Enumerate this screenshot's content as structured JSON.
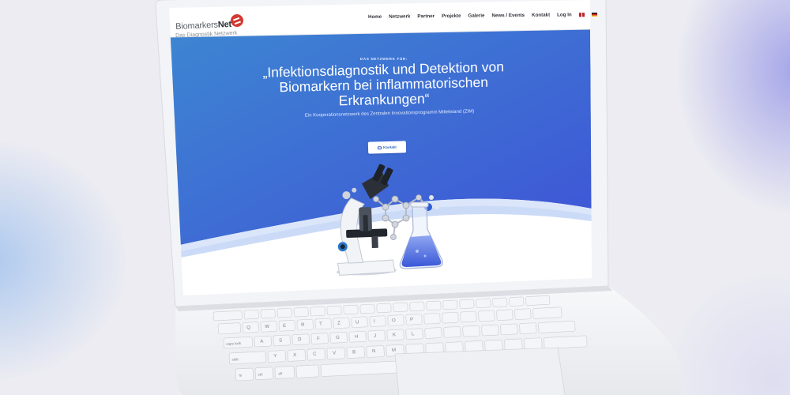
{
  "logo": {
    "name_part1": "Biomarkers",
    "name_part2": "Net",
    "tagline": "Das Diagnostik Netzwerk"
  },
  "nav": {
    "items": [
      "Home",
      "Netzwerk",
      "Partner",
      "Projekte",
      "Galerie",
      "News / Events",
      "Kontakt",
      "Log In"
    ],
    "flags": [
      "flag-uk-icon",
      "flag-de-icon"
    ]
  },
  "hero": {
    "eyebrow": "DAS NETZWERK FÜR:",
    "headline": "„Infektionsdiagnostik und Detektion von Biomarkern bei inflammatorischen Erkrankungen“",
    "subline": "Ein Kooperationsnetzwerk des Zentralen Innovationsprogramm Mittelstand (ZIM)",
    "cta_label": "Kontakt",
    "cta_icon": "mail-icon",
    "illustration": [
      "microscope-icon",
      "molecule-icon",
      "flask-icon"
    ]
  },
  "colors": {
    "hero_gradient_start": "#3d86d2",
    "hero_gradient_end": "#3f54d6",
    "laptop_body": "#f1f2f5",
    "background": "#ececf2",
    "logo_red": "#d33a32"
  },
  "keyboard": {
    "visible_key_labels": [
      "Q",
      "W",
      "E",
      "R",
      "T",
      "Z",
      "U",
      "I",
      "O",
      "P",
      "A",
      "S",
      "D",
      "F",
      "G",
      "H",
      "J",
      "K",
      "L",
      "Y",
      "X",
      "C",
      "V",
      "B",
      "N",
      "M",
      "caps lock",
      "shift",
      "fn",
      "ctrl",
      "alt"
    ]
  }
}
